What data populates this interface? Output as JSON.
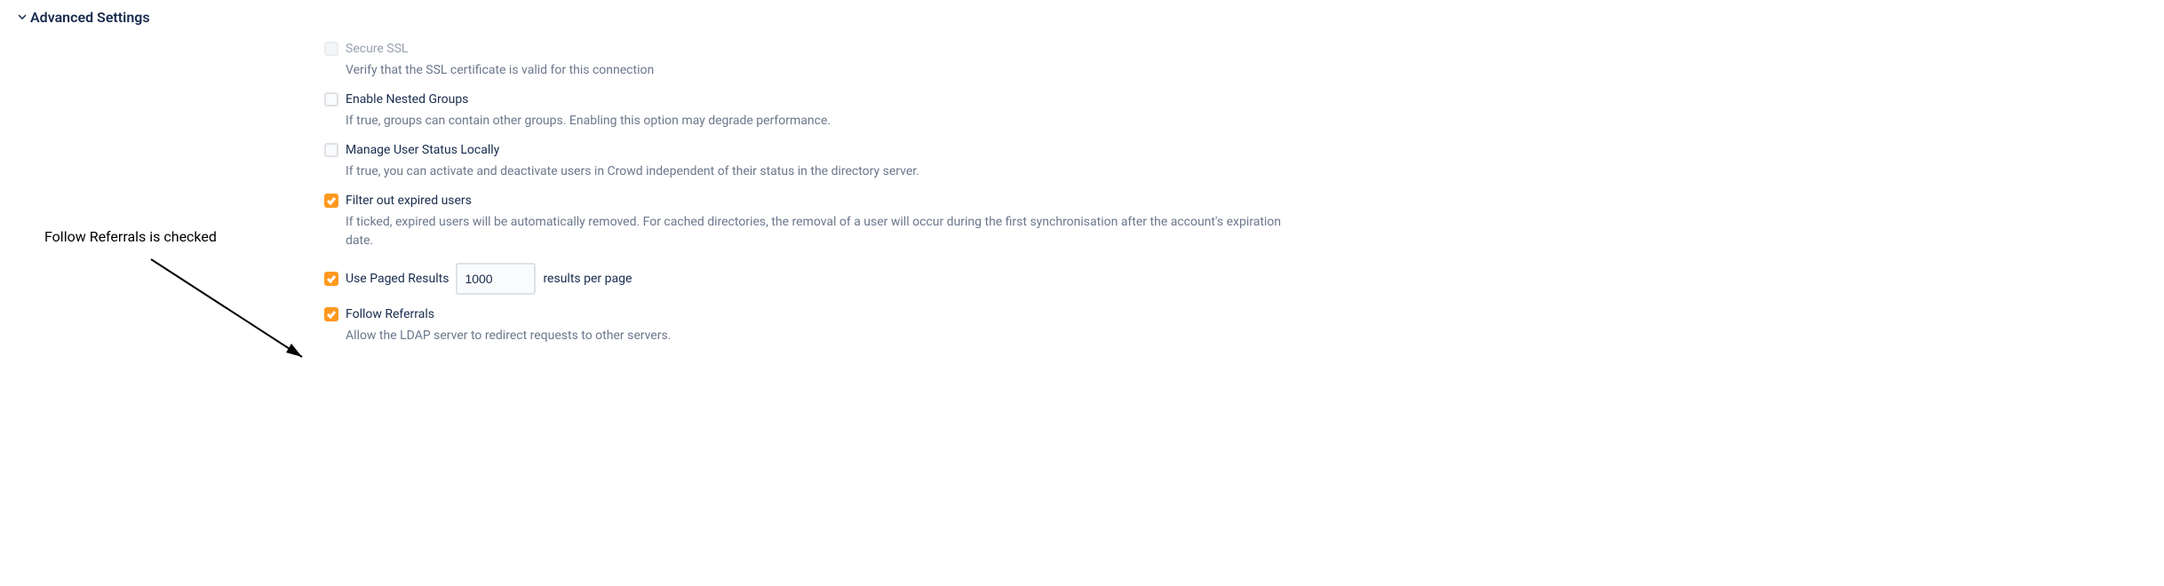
{
  "section": {
    "title": "Advanced Settings"
  },
  "annotation": {
    "text": "Follow Referrals is checked"
  },
  "settings": {
    "secure_ssl": {
      "label": "Secure SSL",
      "description": "Verify that the SSL certificate is valid for this connection",
      "checked": false,
      "disabled": true
    },
    "nested_groups": {
      "label": "Enable Nested Groups",
      "description": "If true, groups can contain other groups. Enabling this option may degrade performance.",
      "checked": false
    },
    "manage_user_status": {
      "label": "Manage User Status Locally",
      "description": "If true, you can activate and deactivate users in Crowd independent of their status in the directory server.",
      "checked": false
    },
    "filter_expired": {
      "label": "Filter out expired users",
      "description": "If ticked, expired users will be automatically removed. For cached directories, the removal of a user will occur during the first synchronisation after the account's expiration date.",
      "checked": true
    },
    "paged_results": {
      "label": "Use Paged Results",
      "value": "1000",
      "suffix": "results per page",
      "checked": true
    },
    "follow_referrals": {
      "label": "Follow Referrals",
      "description": "Allow the LDAP server to redirect requests to other servers.",
      "checked": true
    }
  }
}
